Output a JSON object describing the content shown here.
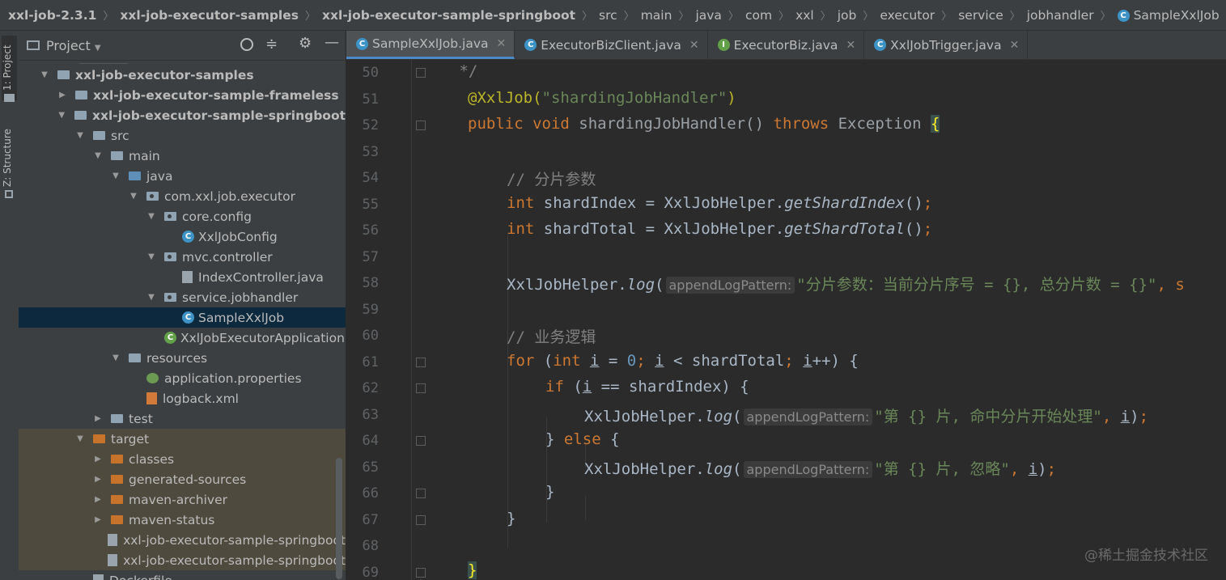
{
  "breadcrumb": [
    {
      "label": "xxl-job-2.3.1",
      "bold": true
    },
    {
      "label": "xxl-job-executor-samples",
      "bold": true
    },
    {
      "label": "xxl-job-executor-sample-springboot",
      "bold": true
    },
    {
      "label": "src"
    },
    {
      "label": "main"
    },
    {
      "label": "java"
    },
    {
      "label": "com"
    },
    {
      "label": "xxl"
    },
    {
      "label": "job"
    },
    {
      "label": "executor"
    },
    {
      "label": "service"
    },
    {
      "label": "jobhandler"
    },
    {
      "label": "SampleXxlJob",
      "icon": "class-icon"
    }
  ],
  "side_tabs": {
    "project": "1: Project",
    "structure": "Z: Structure"
  },
  "panel": {
    "title": "Project"
  },
  "tree": [
    {
      "label": "xxl-job-executor-samples",
      "depth": 0,
      "arrow": "down",
      "icon": "module",
      "bold": true
    },
    {
      "label": "xxl-job-executor-sample-frameless",
      "depth": 1,
      "arrow": "right",
      "icon": "module",
      "bold": true
    },
    {
      "label": "xxl-job-executor-sample-springboot",
      "depth": 1,
      "arrow": "down",
      "icon": "module",
      "bold": true
    },
    {
      "label": "src",
      "depth": 2,
      "arrow": "down",
      "icon": "folder"
    },
    {
      "label": "main",
      "depth": 3,
      "arrow": "down",
      "icon": "folder"
    },
    {
      "label": "java",
      "depth": 4,
      "arrow": "down",
      "icon": "folder-blue"
    },
    {
      "label": "com.xxl.job.executor",
      "depth": 5,
      "arrow": "down",
      "icon": "package"
    },
    {
      "label": "core.config",
      "depth": 6,
      "arrow": "down",
      "icon": "package"
    },
    {
      "label": "XxlJobConfig",
      "depth": 7,
      "arrow": "",
      "icon": "class"
    },
    {
      "label": "mvc.controller",
      "depth": 6,
      "arrow": "down",
      "icon": "package"
    },
    {
      "label": "IndexController.java",
      "depth": 7,
      "arrow": "",
      "icon": "java-file"
    },
    {
      "label": "service.jobhandler",
      "depth": 6,
      "arrow": "down",
      "icon": "package"
    },
    {
      "label": "SampleXxlJob",
      "depth": 7,
      "arrow": "",
      "icon": "class",
      "selected": true
    },
    {
      "label": "XxlJobExecutorApplication",
      "depth": 6,
      "arrow": "",
      "icon": "spring-class"
    },
    {
      "label": "resources",
      "depth": 4,
      "arrow": "down",
      "icon": "folder"
    },
    {
      "label": "application.properties",
      "depth": 5,
      "arrow": "",
      "icon": "properties"
    },
    {
      "label": "logback.xml",
      "depth": 5,
      "arrow": "",
      "icon": "xml"
    },
    {
      "label": "test",
      "depth": 3,
      "arrow": "right",
      "icon": "folder"
    },
    {
      "label": "target",
      "depth": 2,
      "arrow": "down",
      "icon": "folder-orange",
      "target": true
    },
    {
      "label": "classes",
      "depth": 3,
      "arrow": "right",
      "icon": "folder-orange",
      "target": true
    },
    {
      "label": "generated-sources",
      "depth": 3,
      "arrow": "right",
      "icon": "folder-orange",
      "target": true
    },
    {
      "label": "maven-archiver",
      "depth": 3,
      "arrow": "right",
      "icon": "folder-orange",
      "target": true
    },
    {
      "label": "maven-status",
      "depth": 3,
      "arrow": "right",
      "icon": "folder-orange",
      "target": true
    },
    {
      "label": "xxl-job-executor-sample-springboot",
      "depth": 3,
      "arrow": "",
      "icon": "jar",
      "target": true
    },
    {
      "label": "xxl-job-executor-sample-springboot",
      "depth": 3,
      "arrow": "",
      "icon": "jar",
      "target": true
    },
    {
      "label": "Dockerfile",
      "depth": 2,
      "arrow": "",
      "icon": "file"
    }
  ],
  "tabs": [
    {
      "label": "SampleXxlJob.java",
      "icon": "C",
      "active": true
    },
    {
      "label": "ExecutorBizClient.java",
      "icon": "C"
    },
    {
      "label": "ExecutorBiz.java",
      "icon": "I"
    },
    {
      "label": "XxlJobTrigger.java",
      "icon": "C"
    }
  ],
  "line_numbers": [
    "50",
    "51",
    "52",
    "53",
    "54",
    "55",
    "56",
    "57",
    "58",
    "59",
    "60",
    "61",
    "62",
    "63",
    "64",
    "65",
    "66",
    "67",
    "68",
    "69"
  ],
  "code": {
    "l50": " */",
    "l51_ann": "@XxlJob(",
    "l51_str": "\"shardingJobHandler\"",
    "l51_end": ")",
    "l52_kw1": "public void ",
    "l52_name": "shardingJobHandler() ",
    "l52_kw2": "throws ",
    "l52_exc": "Exception ",
    "l52_brace": "{",
    "l54_cmt": "// 分片参数",
    "l55_kw": "int ",
    "l55_a": "shardIndex = XxlJobHelper.",
    "l55_m": "getShardIndex",
    "l55_b": "()",
    "l55_semi": ";",
    "l56_kw": "int ",
    "l56_a": "shardTotal = XxlJobHelper.",
    "l56_m": "getShardTotal",
    "l56_b": "()",
    "l56_semi": ";",
    "l58_a": "XxlJobHelper.",
    "l58_m": "log",
    "l58_b": "(",
    "hint": "appendLogPattern:",
    "l58_str": "\"分片参数：当前分片序号 = {}, 总分片数 = {}\"",
    "l58_tail": ", s",
    "l60_cmt": "// 业务逻辑",
    "l61_kw": "for ",
    "l61_a": "(",
    "l61_kw2": "int ",
    "l61_i": "i",
    "l61_b": " = ",
    "l61_num": "0",
    "l61_semi1": "; ",
    "l61_i2": "i",
    "l61_c": " < shardTotal",
    "l61_semi2": "; ",
    "l61_i3": "i",
    "l61_d": "++) {",
    "l62_kw": "if ",
    "l62_a": "(",
    "l62_i": "i",
    "l62_b": " == shardIndex) {",
    "l63_a": "XxlJobHelper.",
    "l63_m": "log",
    "l63_b": "(",
    "l63_str": "\"第 {} 片, 命中分片开始处理\"",
    "l63_c": ", ",
    "l63_i": "i",
    "l63_d": ")",
    "l63_semi": ";",
    "l64_a": "} ",
    "l64_kw": "else ",
    "l64_b": "{",
    "l65_a": "XxlJobHelper.",
    "l65_m": "log",
    "l65_b": "(",
    "l65_str": "\"第 {} 片, 忽略\"",
    "l65_c": ", ",
    "l65_i": "i",
    "l65_d": ")",
    "l65_semi": ";",
    "l66": "}",
    "l67": "}",
    "l69": "}"
  },
  "watermark": "@稀土掘金技术社区",
  "colors": {
    "keyword": "#cc7832",
    "string": "#6a8759",
    "comment": "#808080",
    "annotation": "#bbb529",
    "selection": "#0d293e",
    "tab_underline": "#4a88c7"
  }
}
